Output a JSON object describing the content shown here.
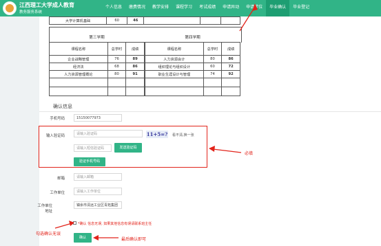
{
  "header": {
    "title": "江西理工大学成人教育",
    "subtitle": "教务服务系统",
    "nav": [
      "个人信息",
      "缴费情况",
      "教学安排",
      "课程学习",
      "考试成绩",
      "申请异动",
      "申请学位",
      "毕业确认",
      "毕业登记"
    ],
    "active_nav": "毕业确认"
  },
  "top_row": {
    "name": "大学计算机基础",
    "hours": "60",
    "score": "46"
  },
  "semesters": [
    {
      "title": "第三学期",
      "headers": [
        "课程名称",
        "总学时",
        "成绩"
      ],
      "rows": [
        {
          "name": "企业战略管理",
          "hours": "76",
          "score": "89"
        },
        {
          "name": "经济法",
          "hours": "68",
          "score": "86"
        },
        {
          "name": "人力资源管理概论",
          "hours": "80",
          "score": "91"
        }
      ]
    },
    {
      "title": "第四学期",
      "headers": [
        "课程名称",
        "总学时",
        "成绩"
      ],
      "rows": [
        {
          "name": "人力资源会计",
          "hours": "80",
          "score": "86"
        },
        {
          "name": "组织理论与组织设计",
          "hours": "60",
          "score": "72"
        },
        {
          "name": "职业生涯设计与管理",
          "hours": "74",
          "score": "92"
        }
      ]
    }
  ],
  "confirm": {
    "section_title": "确认信息",
    "phone_label": "手机号码",
    "phone_value": "15150077973",
    "captcha_label": "输入验证码",
    "captcha_placeholder": "请输入验证码",
    "captcha_text": "11+5=?",
    "refresh_text": "看不清,换一张",
    "sms_placeholder": "请输入短信验证码",
    "send_sms_button": "发送验证码",
    "verify_phone_button": "验证手机号码",
    "email_label": "邮箱",
    "email_placeholder": "请输入邮箱",
    "work_label": "工作单位",
    "work_placeholder": "请输入工作单位",
    "work_addr_label": "工作单位地址",
    "work_addr_value": "镇余市清远工业区青拓集团",
    "note_text": "*确认 信息无误, 如果其他信息有误请联系班主任",
    "confirm_button": "确认"
  },
  "annotations": {
    "required": "必填",
    "check_confirm": "勾选确认无误",
    "final_confirm": "最后确认即可"
  },
  "colors": {
    "brand": "#31b487",
    "annotation": "#e2231a",
    "active_nav": "#1d9e72"
  }
}
